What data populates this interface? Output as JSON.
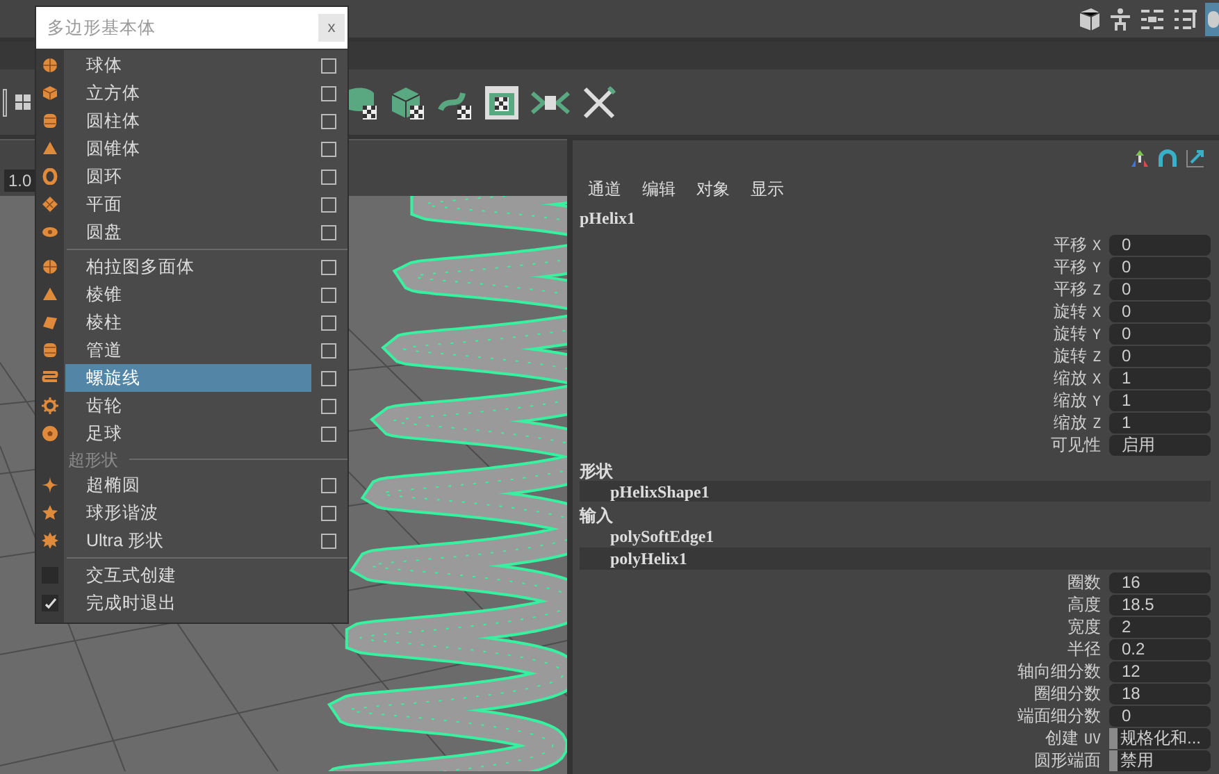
{
  "menu": {
    "title": "多边形基本体",
    "close": "x",
    "items": [
      {
        "kind": "option",
        "label": "球体",
        "selected": false
      },
      {
        "kind": "option",
        "label": "立方体",
        "selected": false
      },
      {
        "kind": "option",
        "label": "圆柱体",
        "selected": false
      },
      {
        "kind": "option",
        "label": "圆锥体",
        "selected": false
      },
      {
        "kind": "option",
        "label": "圆环",
        "selected": false
      },
      {
        "kind": "option",
        "label": "平面",
        "selected": false
      },
      {
        "kind": "option",
        "label": "圆盘",
        "selected": false
      },
      {
        "kind": "divider"
      },
      {
        "kind": "option",
        "label": "柏拉图多面体",
        "selected": false
      },
      {
        "kind": "option",
        "label": "棱锥",
        "selected": false
      },
      {
        "kind": "option",
        "label": "棱柱",
        "selected": false
      },
      {
        "kind": "option",
        "label": "管道",
        "selected": false
      },
      {
        "kind": "option",
        "label": "螺旋线",
        "selected": true
      },
      {
        "kind": "option",
        "label": "齿轮",
        "selected": false
      },
      {
        "kind": "option",
        "label": "足球",
        "selected": false
      },
      {
        "kind": "header",
        "label": "超形状"
      },
      {
        "kind": "option",
        "label": "超椭圆",
        "selected": false
      },
      {
        "kind": "option",
        "label": "球形谐波",
        "selected": false
      },
      {
        "kind": "option",
        "label": "Ultra 形状",
        "selected": false
      },
      {
        "kind": "divider"
      },
      {
        "kind": "toggle",
        "label": "交互式创建",
        "checked": false
      },
      {
        "kind": "toggle",
        "label": "完成时退出",
        "checked": true
      }
    ]
  },
  "viewport": {
    "field": "1.0"
  },
  "channel_box": {
    "tabs": [
      "通道",
      "编辑",
      "对象",
      "显示"
    ],
    "object": "pHelix1",
    "transform": [
      {
        "label": "平移",
        "axis": "X",
        "value": "0"
      },
      {
        "label": "平移",
        "axis": "Y",
        "value": "0"
      },
      {
        "label": "平移",
        "axis": "Z",
        "value": "0"
      },
      {
        "label": "旋转",
        "axis": "X",
        "value": "0"
      },
      {
        "label": "旋转",
        "axis": "Y",
        "value": "0"
      },
      {
        "label": "旋转",
        "axis": "Z",
        "value": "0"
      },
      {
        "label": "缩放",
        "axis": "X",
        "value": "1"
      },
      {
        "label": "缩放",
        "axis": "Y",
        "value": "1"
      },
      {
        "label": "缩放",
        "axis": "Z",
        "value": "1"
      },
      {
        "label": "可见性",
        "value": "启用"
      }
    ],
    "shape_heading": "形状",
    "shape": "pHelixShape1",
    "inputs_heading": "输入",
    "inputs": [
      {
        "name": "polySoftEdge1",
        "selected": false
      },
      {
        "name": "polyHelix1",
        "selected": true
      }
    ],
    "helix_attrs": [
      {
        "kind": "number",
        "label": "圈数",
        "value": "16"
      },
      {
        "kind": "number",
        "label": "高度",
        "value": "18.5"
      },
      {
        "kind": "number",
        "label": "宽度",
        "value": "2"
      },
      {
        "kind": "number",
        "label": "半径",
        "value": "0.2"
      },
      {
        "kind": "number",
        "label": "轴向细分数",
        "value": "12"
      },
      {
        "kind": "number",
        "label": "圈细分数",
        "value": "18"
      },
      {
        "kind": "number",
        "label": "端面细分数",
        "value": "0"
      },
      {
        "kind": "enum",
        "label": "创建",
        "axis": "UV",
        "value": "规格化和..."
      },
      {
        "kind": "enum",
        "label": "圆形端面",
        "value": "禁用"
      }
    ]
  }
}
